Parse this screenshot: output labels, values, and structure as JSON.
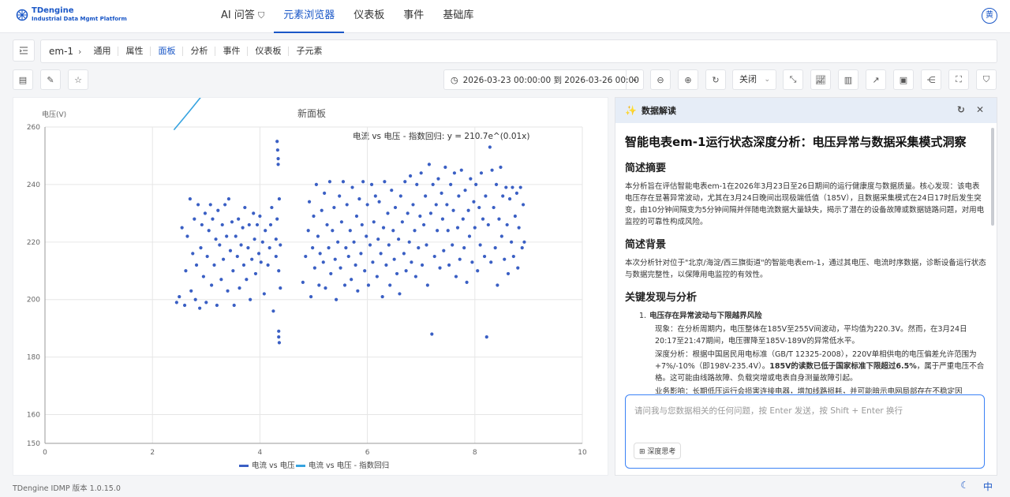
{
  "app": {
    "logo_title": "TDengine",
    "logo_subtitle": "Industrial Data Mgmt Platform",
    "avatar": "黄",
    "version": "TDengine IDMP 版本 1.0.15.0",
    "lang": "中"
  },
  "nav": {
    "tabs": [
      {
        "label": "AI 问答",
        "icon": "shield-icon"
      },
      {
        "label": "元素浏览器"
      },
      {
        "label": "仪表板"
      },
      {
        "label": "事件"
      },
      {
        "label": "基础库"
      }
    ],
    "active_index": 1
  },
  "breadcrumb": {
    "root": "em-1",
    "items": [
      "通用",
      "属性",
      "面板",
      "分析",
      "事件",
      "仪表板",
      "子元素"
    ],
    "active_index": 2
  },
  "toolbar": {
    "time_range": "2026-03-23 00:00:00 到 2026-03-26 00:00",
    "refresh_select": "关闭"
  },
  "colors": {
    "accent": "#1a57c7",
    "scatter": "#3a5fc4",
    "trend": "#36a3e0"
  },
  "chart_data": {
    "type": "scatter",
    "title": "新面板",
    "ylabel": "电压(V)",
    "xlabel": "",
    "xlim": [
      0,
      10
    ],
    "ylim": [
      150,
      260
    ],
    "xticks": [
      0,
      2,
      4,
      6,
      8,
      10
    ],
    "yticks": [
      150,
      160,
      180,
      200,
      220,
      240,
      260
    ],
    "annotation": "电流 vs 电压 - 指数回归: y = 210.7e^(0.01x)",
    "regression": {
      "a": 210.7,
      "b": 0.01,
      "x_range": [
        2.4,
        8.9
      ]
    },
    "grid": true,
    "legend_position": "bottom",
    "series": [
      {
        "name": "电流 vs 电压",
        "kind": "scatter",
        "points": [
          [
            2.45,
            199
          ],
          [
            2.5,
            201
          ],
          [
            2.55,
            225
          ],
          [
            2.6,
            198
          ],
          [
            2.62,
            210
          ],
          [
            2.65,
            222
          ],
          [
            2.7,
            235
          ],
          [
            2.72,
            203
          ],
          [
            2.75,
            216
          ],
          [
            2.78,
            228
          ],
          [
            2.8,
            200
          ],
          [
            2.82,
            212
          ],
          [
            2.85,
            233
          ],
          [
            2.88,
            197
          ],
          [
            2.9,
            218
          ],
          [
            2.92,
            226
          ],
          [
            2.95,
            208
          ],
          [
            2.98,
            230
          ],
          [
            3.0,
            199
          ],
          [
            3.02,
            215
          ],
          [
            3.05,
            224
          ],
          [
            3.08,
            233
          ],
          [
            3.1,
            205
          ],
          [
            3.12,
            228
          ],
          [
            3.15,
            212
          ],
          [
            3.18,
            221
          ],
          [
            3.2,
            198
          ],
          [
            3.22,
            231
          ],
          [
            3.25,
            219
          ],
          [
            3.28,
            207
          ],
          [
            3.3,
            226
          ],
          [
            3.32,
            214
          ],
          [
            3.35,
            233
          ],
          [
            3.38,
            222
          ],
          [
            3.4,
            203
          ],
          [
            3.42,
            235
          ],
          [
            3.45,
            217
          ],
          [
            3.48,
            227
          ],
          [
            3.5,
            210
          ],
          [
            3.52,
            198
          ],
          [
            3.55,
            222
          ],
          [
            3.58,
            215
          ],
          [
            3.6,
            228
          ],
          [
            3.62,
            204
          ],
          [
            3.65,
            219
          ],
          [
            3.68,
            225
          ],
          [
            3.7,
            212
          ],
          [
            3.72,
            232
          ],
          [
            3.75,
            207
          ],
          [
            3.78,
            218
          ],
          [
            3.8,
            226
          ],
          [
            3.82,
            200
          ],
          [
            3.85,
            214
          ],
          [
            3.88,
            230
          ],
          [
            3.9,
            221
          ],
          [
            3.92,
            209
          ],
          [
            3.95,
            226
          ],
          [
            3.98,
            216
          ],
          [
            4.0,
            229
          ],
          [
            4.02,
            213
          ],
          [
            4.05,
            220
          ],
          [
            4.08,
            202
          ],
          [
            4.1,
            224
          ],
          [
            4.15,
            212
          ],
          [
            4.18,
            218
          ],
          [
            4.2,
            226
          ],
          [
            4.22,
            232
          ],
          [
            4.25,
            196
          ],
          [
            4.3,
            215
          ],
          [
            4.32,
            255
          ],
          [
            4.33,
            252
          ],
          [
            4.34,
            249
          ],
          [
            4.34,
            247
          ],
          [
            4.35,
            189
          ],
          [
            4.35,
            187
          ],
          [
            4.36,
            185
          ],
          [
            4.3,
            221
          ],
          [
            4.32,
            228
          ],
          [
            4.35,
            210
          ],
          [
            4.36,
            235
          ],
          [
            4.38,
            204
          ],
          [
            4.38,
            219
          ],
          [
            4.8,
            206
          ],
          [
            4.85,
            215
          ],
          [
            4.9,
            224
          ],
          [
            4.92,
            234
          ],
          [
            4.95,
            201
          ],
          [
            4.98,
            218
          ],
          [
            5.0,
            229
          ],
          [
            5.02,
            211
          ],
          [
            5.05,
            240
          ],
          [
            5.08,
            222
          ],
          [
            5.1,
            205
          ],
          [
            5.12,
            216
          ],
          [
            5.15,
            231
          ],
          [
            5.18,
            213
          ],
          [
            5.2,
            237
          ],
          [
            5.22,
            204
          ],
          [
            5.25,
            226
          ],
          [
            5.28,
            218
          ],
          [
            5.3,
            241
          ],
          [
            5.32,
            209
          ],
          [
            5.35,
            224
          ],
          [
            5.38,
            232
          ],
          [
            5.4,
            214
          ],
          [
            5.42,
            200
          ],
          [
            5.45,
            220
          ],
          [
            5.48,
            236
          ],
          [
            5.5,
            211
          ],
          [
            5.52,
            227
          ],
          [
            5.55,
            241
          ],
          [
            5.58,
            205
          ],
          [
            5.6,
            218
          ],
          [
            5.62,
            233
          ],
          [
            5.65,
            215
          ],
          [
            5.68,
            224
          ],
          [
            5.7,
            207
          ],
          [
            5.72,
            239
          ],
          [
            5.75,
            220
          ],
          [
            5.78,
            212
          ],
          [
            5.8,
            229
          ],
          [
            5.82,
            203
          ],
          [
            5.85,
            235
          ],
          [
            5.88,
            216
          ],
          [
            5.9,
            226
          ],
          [
            5.92,
            241
          ],
          [
            5.95,
            210
          ],
          [
            5.98,
            222
          ],
          [
            6.0,
            233
          ],
          [
            6.02,
            205
          ],
          [
            6.05,
            219
          ],
          [
            6.08,
            240
          ],
          [
            6.1,
            213
          ],
          [
            6.12,
            227
          ],
          [
            6.15,
            236
          ],
          [
            6.18,
            208
          ],
          [
            6.2,
            221
          ],
          [
            6.22,
            234
          ],
          [
            6.25,
            216
          ],
          [
            6.28,
            201
          ],
          [
            6.3,
            225
          ],
          [
            6.32,
            241
          ],
          [
            6.35,
            212
          ],
          [
            6.38,
            230
          ],
          [
            6.4,
            219
          ],
          [
            6.42,
            205
          ],
          [
            6.45,
            238
          ],
          [
            6.48,
            224
          ],
          [
            6.5,
            214
          ],
          [
            6.52,
            232
          ],
          [
            6.55,
            209
          ],
          [
            6.58,
            221
          ],
          [
            6.6,
            202
          ],
          [
            6.62,
            236
          ],
          [
            6.65,
            227
          ],
          [
            6.68,
            216
          ],
          [
            6.7,
            241
          ],
          [
            6.72,
            210
          ],
          [
            6.75,
            230
          ],
          [
            6.78,
            220
          ],
          [
            6.8,
            243
          ],
          [
            6.82,
            213
          ],
          [
            6.85,
            233
          ],
          [
            6.88,
            224
          ],
          [
            6.9,
            208
          ],
          [
            6.92,
            240
          ],
          [
            6.95,
            218
          ],
          [
            6.98,
            229
          ],
          [
            7.0,
            244
          ],
          [
            7.02,
            212
          ],
          [
            7.05,
            226
          ],
          [
            7.08,
            236
          ],
          [
            7.1,
            219
          ],
          [
            7.12,
            205
          ],
          [
            7.15,
            247
          ],
          [
            7.18,
            230
          ],
          [
            7.2,
            188
          ],
          [
            7.22,
            240
          ],
          [
            7.25,
            215
          ],
          [
            7.28,
            233
          ],
          [
            7.3,
            224
          ],
          [
            7.32,
            242
          ],
          [
            7.35,
            211
          ],
          [
            7.38,
            237
          ],
          [
            7.4,
            228
          ],
          [
            7.42,
            217
          ],
          [
            7.45,
            246
          ],
          [
            7.48,
            233
          ],
          [
            7.5,
            224
          ],
          [
            7.52,
            212
          ],
          [
            7.55,
            240
          ],
          [
            7.58,
            219
          ],
          [
            7.6,
            231
          ],
          [
            7.62,
            244
          ],
          [
            7.65,
            208
          ],
          [
            7.68,
            225
          ],
          [
            7.7,
            236
          ],
          [
            7.72,
            214
          ],
          [
            7.75,
            245
          ],
          [
            7.78,
            228
          ],
          [
            7.8,
            218
          ],
          [
            7.82,
            238
          ],
          [
            7.85,
            206
          ],
          [
            7.88,
            231
          ],
          [
            7.9,
            222
          ],
          [
            7.92,
            242
          ],
          [
            7.95,
            213
          ],
          [
            7.98,
            234
          ],
          [
            8.0,
            225
          ],
          [
            8.02,
            240
          ],
          [
            8.05,
            210
          ],
          [
            8.08,
            232
          ],
          [
            8.1,
            219
          ],
          [
            8.12,
            244
          ],
          [
            8.15,
            228
          ],
          [
            8.18,
            215
          ],
          [
            8.2,
            236
          ],
          [
            8.22,
            187
          ],
          [
            8.25,
            226
          ],
          [
            8.28,
            253
          ],
          [
            8.3,
            213
          ],
          [
            8.32,
            245
          ],
          [
            8.35,
            232
          ],
          [
            8.38,
            218
          ],
          [
            8.4,
            240
          ],
          [
            8.42,
            205
          ],
          [
            8.45,
            228
          ],
          [
            8.48,
            246
          ],
          [
            8.5,
            222
          ],
          [
            8.52,
            236
          ],
          [
            8.55,
            214
          ],
          [
            8.58,
            239
          ],
          [
            8.6,
            226
          ],
          [
            8.62,
            209
          ],
          [
            8.65,
            235
          ],
          [
            8.68,
            220
          ],
          [
            8.7,
            239
          ],
          [
            8.72,
            215
          ],
          [
            8.75,
            229
          ],
          [
            8.78,
            237
          ],
          [
            8.8,
            211
          ],
          [
            8.82,
            225
          ],
          [
            8.85,
            239
          ],
          [
            8.88,
            218
          ],
          [
            8.9,
            233
          ],
          [
            8.92,
            220
          ]
        ]
      },
      {
        "name": "电流 vs 电压 - 指数回归",
        "kind": "line"
      }
    ]
  },
  "ai": {
    "header": "数据解读",
    "title": "智能电表em-1运行状态深度分析：电压异常与数据采集模式洞察",
    "sections": [
      {
        "heading": "简述摘要",
        "text": "本分析旨在评估智能电表em-1在2026年3月23日至26日期间的运行健康度与数据质量。核心发现：该电表电压存在显著异常波动，尤其在3月24日晚间出现极端低值（185V），且数据采集模式在24日17时后发生突变，由10分钟间隔变为5分钟间隔并伴随电流数据大量缺失，揭示了潜在的设备故障或数据链路问题，对用电监控的可靠性构成风险。"
      },
      {
        "heading": "简述背景",
        "text": "本次分析针对位于\"北京/海淀/西三旗街道\"的智能电表em-1，通过其电压、电流时序数据，诊断设备运行状态与数据完整性，以保障用电监控的有效性。"
      },
      {
        "heading": "关键发现与分析"
      }
    ],
    "finding_title": "电压存在异常波动与下限越界风险",
    "finding_phenomenon": "现象：在分析周期内，电压整体在185V至255V间波动，平均值为220.3V。然而，在3月24日20:17至21:47期间，电压骤降至185V-189V的异常低水平。",
    "finding_analysis_a": "深度分析：根据中国居民用电标准（GB/T 12325-2008），220V单相供电的电压偏差允许范围为+7%/-10%（即198V-235.4V）。",
    "finding_analysis_b": "185V的读数已低于国家标准下限超过6.5%",
    "finding_analysis_c": "，属于严重电压不合格。这可能由线路故障、负载突增或电表自身测量故障引起。",
    "finding_impact": "业务影响：长期低压运行会损害连接电器，增加线路损耗，并可能暗示电网局部存在不稳定因",
    "input_placeholder": "请问我与您数据相关的任何问题，按 Enter 发送，按 Shift + Enter 换行",
    "deep_think": "深度思考"
  }
}
